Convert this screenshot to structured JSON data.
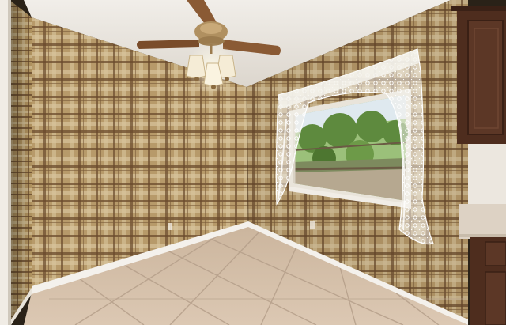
{
  "scene": {
    "subject": "empty-room-interior",
    "elements": [
      "textured-ceiling",
      "ceiling-fan",
      "light-fixture",
      "plaid-wallpaper-wall-left",
      "plaid-wallpaper-wall-back",
      "plaid-wallpaper-wall-right",
      "window",
      "lace-curtain",
      "tile-floor",
      "baseboard",
      "cabinet",
      "countertop"
    ]
  },
  "colors": {
    "ceiling": "#ece8e2",
    "wallpaper_base": "#b79a6a",
    "wallpaper_stripe_dark": "#6a4a2c",
    "wallpaper_stripe_light": "#d8c49c",
    "floor_tile": "#d2bda7",
    "grout": "#b59f8a",
    "baseboard": "#f4f1ec",
    "cabinet": "#4e2d1e",
    "countertop": "#ddd2c4",
    "fan_blade": "#8a5a34",
    "fan_metal": "#b09060",
    "curtain": "#f3f1ec",
    "foliage": "#5e8a3e"
  }
}
